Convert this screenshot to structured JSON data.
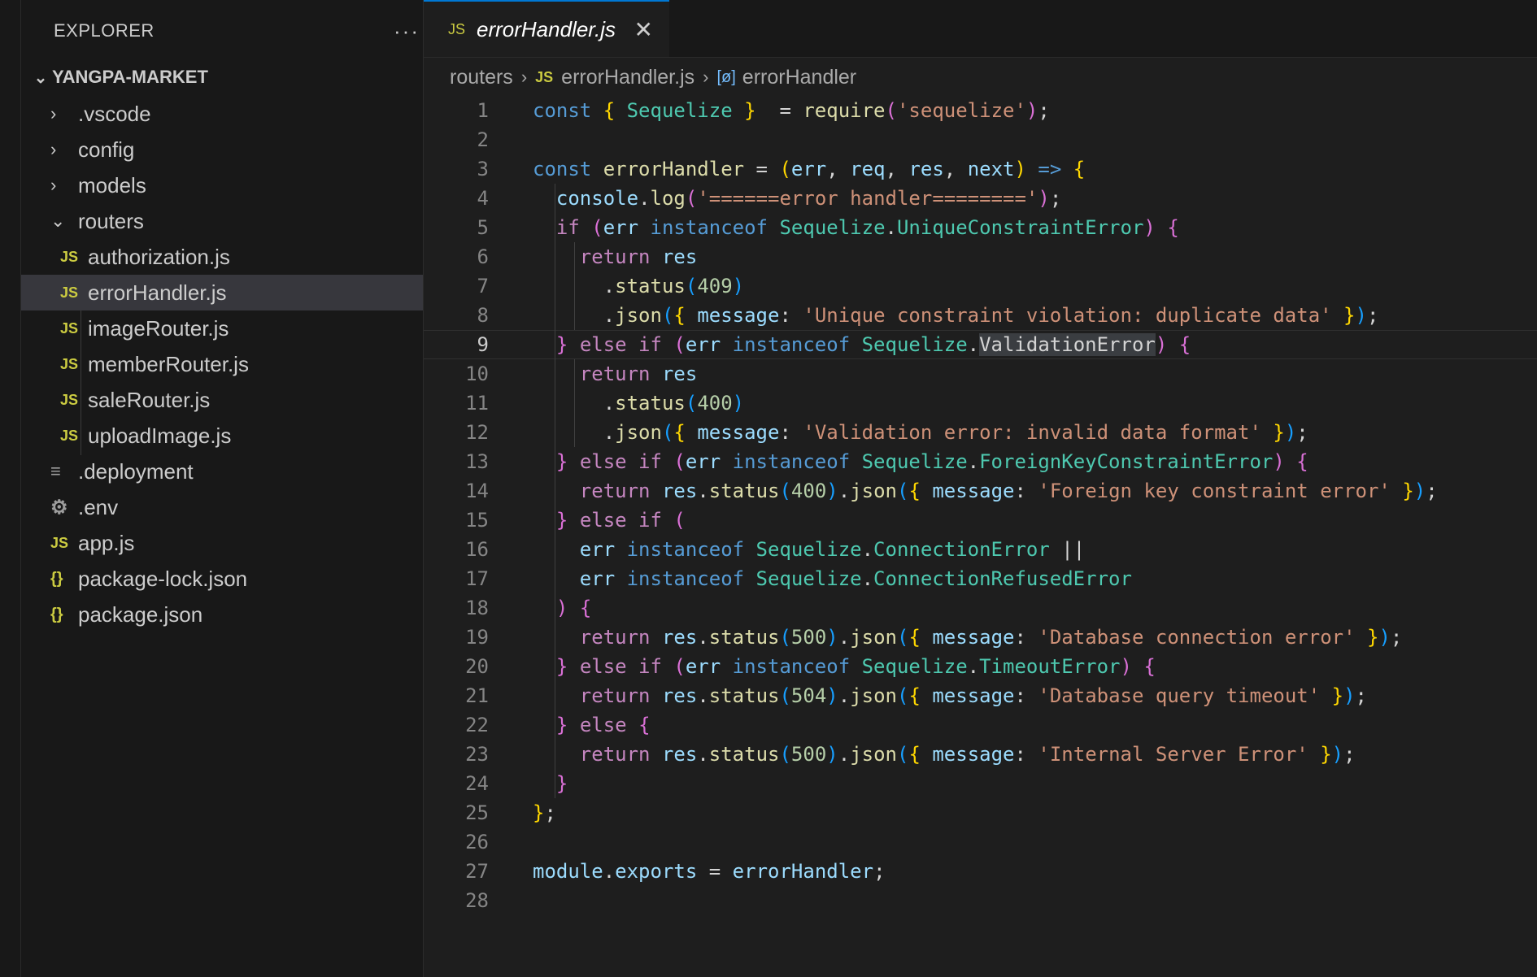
{
  "explorer": {
    "title": "EXPLORER",
    "more": "···",
    "project": "YANGPA-MARKET",
    "items": [
      {
        "label": ".vscode",
        "kind": "folder",
        "depth": 1
      },
      {
        "label": "config",
        "kind": "folder",
        "depth": 1
      },
      {
        "label": "models",
        "kind": "folder",
        "depth": 1
      },
      {
        "label": "routers",
        "kind": "folder-open",
        "depth": 1
      },
      {
        "label": "authorization.js",
        "kind": "js",
        "depth": 2
      },
      {
        "label": "errorHandler.js",
        "kind": "js",
        "depth": 2,
        "active": true
      },
      {
        "label": "imageRouter.js",
        "kind": "js",
        "depth": 2
      },
      {
        "label": "memberRouter.js",
        "kind": "js",
        "depth": 2
      },
      {
        "label": "saleRouter.js",
        "kind": "js",
        "depth": 2
      },
      {
        "label": "uploadImage.js",
        "kind": "js",
        "depth": 2
      },
      {
        "label": ".deployment",
        "kind": "lines",
        "depth": 1
      },
      {
        "label": ".env",
        "kind": "gear",
        "depth": 1
      },
      {
        "label": "app.js",
        "kind": "js",
        "depth": 1
      },
      {
        "label": "package-lock.json",
        "kind": "json",
        "depth": 1
      },
      {
        "label": "package.json",
        "kind": "json",
        "depth": 1
      }
    ]
  },
  "icons": {
    "js": "JS",
    "json": "{}",
    "gear": "⚙",
    "lines": "≡"
  },
  "tab": {
    "title": "errorHandler.js",
    "close": "✕"
  },
  "breadcrumb": {
    "folder": "routers",
    "file": "errorHandler.js",
    "symbol": "errorHandler"
  },
  "editor": {
    "current_line": 9,
    "lines": [
      [
        [
          "kw",
          "const "
        ],
        [
          "br1",
          "{ "
        ],
        [
          "ty",
          "Sequelize"
        ],
        [
          "br1",
          " }"
        ],
        [
          "",
          "  = "
        ],
        [
          "fn",
          "require"
        ],
        [
          "br2",
          "("
        ],
        [
          "str",
          "'sequelize'"
        ],
        [
          "br2",
          ")"
        ],
        [
          "",
          ";"
        ]
      ],
      [],
      [
        [
          "kw",
          "const "
        ],
        [
          "fn",
          "errorHandler"
        ],
        [
          "",
          " = "
        ],
        [
          "br1",
          "("
        ],
        [
          "vr",
          "err"
        ],
        [
          "",
          ", "
        ],
        [
          "vr",
          "req"
        ],
        [
          "",
          ", "
        ],
        [
          "vr",
          "res"
        ],
        [
          "",
          ", "
        ],
        [
          "vr",
          "next"
        ],
        [
          "br1",
          ")"
        ],
        [
          "",
          " "
        ],
        [
          "kw",
          "=>"
        ],
        [
          "",
          " "
        ],
        [
          "br1",
          "{"
        ]
      ],
      [
        [
          "",
          "  "
        ],
        [
          "vr",
          "console"
        ],
        [
          "",
          "."
        ],
        [
          "fn",
          "log"
        ],
        [
          "br2",
          "("
        ],
        [
          "str",
          "'======error handler========'"
        ],
        [
          "br2",
          ")"
        ],
        [
          "",
          ";"
        ]
      ],
      [
        [
          "",
          "  "
        ],
        [
          "ctl",
          "if "
        ],
        [
          "br2",
          "("
        ],
        [
          "vr",
          "err "
        ],
        [
          "kw",
          "instanceof "
        ],
        [
          "ty",
          "Sequelize"
        ],
        [
          "",
          "."
        ],
        [
          "ty",
          "UniqueConstraintError"
        ],
        [
          "br2",
          ")"
        ],
        [
          "",
          " "
        ],
        [
          "br2",
          "{"
        ]
      ],
      [
        [
          "",
          "    "
        ],
        [
          "ctl",
          "return "
        ],
        [
          "vr",
          "res"
        ]
      ],
      [
        [
          "",
          "      ."
        ],
        [
          "fn",
          "status"
        ],
        [
          "br3",
          "("
        ],
        [
          "num",
          "409"
        ],
        [
          "br3",
          ")"
        ]
      ],
      [
        [
          "",
          "      ."
        ],
        [
          "fn",
          "json"
        ],
        [
          "br3",
          "("
        ],
        [
          "br1",
          "{ "
        ],
        [
          "vr",
          "message"
        ],
        [
          "",
          ": "
        ],
        [
          "str",
          "'Unique constraint violation: duplicate data'"
        ],
        [
          "br1",
          " }"
        ],
        [
          "br3",
          ")"
        ],
        [
          "",
          ";"
        ]
      ],
      [
        [
          "",
          "  "
        ],
        [
          "br2",
          "}"
        ],
        [
          "",
          " "
        ],
        [
          "ctl",
          "else if "
        ],
        [
          "br2",
          "("
        ],
        [
          "vr",
          "err "
        ],
        [
          "kw",
          "instanceof "
        ],
        [
          "ty",
          "Sequelize"
        ],
        [
          "",
          "."
        ],
        [
          "hl",
          "ValidationError"
        ],
        [
          "br2",
          ")"
        ],
        [
          "",
          " "
        ],
        [
          "br2",
          "{"
        ]
      ],
      [
        [
          "",
          "    "
        ],
        [
          "ctl",
          "return "
        ],
        [
          "vr",
          "res"
        ]
      ],
      [
        [
          "",
          "      ."
        ],
        [
          "fn",
          "status"
        ],
        [
          "br3",
          "("
        ],
        [
          "num",
          "400"
        ],
        [
          "br3",
          ")"
        ]
      ],
      [
        [
          "",
          "      ."
        ],
        [
          "fn",
          "json"
        ],
        [
          "br3",
          "("
        ],
        [
          "br1",
          "{ "
        ],
        [
          "vr",
          "message"
        ],
        [
          "",
          ": "
        ],
        [
          "str",
          "'Validation error: invalid data format'"
        ],
        [
          "br1",
          " }"
        ],
        [
          "br3",
          ")"
        ],
        [
          "",
          ";"
        ]
      ],
      [
        [
          "",
          "  "
        ],
        [
          "br2",
          "}"
        ],
        [
          "",
          " "
        ],
        [
          "ctl",
          "else if "
        ],
        [
          "br2",
          "("
        ],
        [
          "vr",
          "err "
        ],
        [
          "kw",
          "instanceof "
        ],
        [
          "ty",
          "Sequelize"
        ],
        [
          "",
          "."
        ],
        [
          "ty",
          "ForeignKeyConstraintError"
        ],
        [
          "br2",
          ")"
        ],
        [
          "",
          " "
        ],
        [
          "br2",
          "{"
        ]
      ],
      [
        [
          "",
          "    "
        ],
        [
          "ctl",
          "return "
        ],
        [
          "vr",
          "res"
        ],
        [
          "",
          "."
        ],
        [
          "fn",
          "status"
        ],
        [
          "br3",
          "("
        ],
        [
          "num",
          "400"
        ],
        [
          "br3",
          ")"
        ],
        [
          "",
          "."
        ],
        [
          "fn",
          "json"
        ],
        [
          "br3",
          "("
        ],
        [
          "br1",
          "{ "
        ],
        [
          "vr",
          "message"
        ],
        [
          "",
          ": "
        ],
        [
          "str",
          "'Foreign key constraint error'"
        ],
        [
          "br1",
          " }"
        ],
        [
          "br3",
          ")"
        ],
        [
          "",
          ";"
        ]
      ],
      [
        [
          "",
          "  "
        ],
        [
          "br2",
          "}"
        ],
        [
          "",
          " "
        ],
        [
          "ctl",
          "else if "
        ],
        [
          "br2",
          "("
        ]
      ],
      [
        [
          "",
          "    "
        ],
        [
          "vr",
          "err "
        ],
        [
          "kw",
          "instanceof "
        ],
        [
          "ty",
          "Sequelize"
        ],
        [
          "",
          "."
        ],
        [
          "ty",
          "ConnectionError"
        ],
        [
          "",
          " ||"
        ]
      ],
      [
        [
          "",
          "    "
        ],
        [
          "vr",
          "err "
        ],
        [
          "kw",
          "instanceof "
        ],
        [
          "ty",
          "Sequelize"
        ],
        [
          "",
          "."
        ],
        [
          "ty",
          "ConnectionRefusedError"
        ]
      ],
      [
        [
          "",
          "  "
        ],
        [
          "br2",
          ")"
        ],
        [
          "",
          " "
        ],
        [
          "br2",
          "{"
        ]
      ],
      [
        [
          "",
          "    "
        ],
        [
          "ctl",
          "return "
        ],
        [
          "vr",
          "res"
        ],
        [
          "",
          "."
        ],
        [
          "fn",
          "status"
        ],
        [
          "br3",
          "("
        ],
        [
          "num",
          "500"
        ],
        [
          "br3",
          ")"
        ],
        [
          "",
          "."
        ],
        [
          "fn",
          "json"
        ],
        [
          "br3",
          "("
        ],
        [
          "br1",
          "{ "
        ],
        [
          "vr",
          "message"
        ],
        [
          "",
          ": "
        ],
        [
          "str",
          "'Database connection error'"
        ],
        [
          "br1",
          " }"
        ],
        [
          "br3",
          ")"
        ],
        [
          "",
          ";"
        ]
      ],
      [
        [
          "",
          "  "
        ],
        [
          "br2",
          "}"
        ],
        [
          "",
          " "
        ],
        [
          "ctl",
          "else if "
        ],
        [
          "br2",
          "("
        ],
        [
          "vr",
          "err "
        ],
        [
          "kw",
          "instanceof "
        ],
        [
          "ty",
          "Sequelize"
        ],
        [
          "",
          "."
        ],
        [
          "ty",
          "TimeoutError"
        ],
        [
          "br2",
          ")"
        ],
        [
          "",
          " "
        ],
        [
          "br2",
          "{"
        ]
      ],
      [
        [
          "",
          "    "
        ],
        [
          "ctl",
          "return "
        ],
        [
          "vr",
          "res"
        ],
        [
          "",
          "."
        ],
        [
          "fn",
          "status"
        ],
        [
          "br3",
          "("
        ],
        [
          "num",
          "504"
        ],
        [
          "br3",
          ")"
        ],
        [
          "",
          "."
        ],
        [
          "fn",
          "json"
        ],
        [
          "br3",
          "("
        ],
        [
          "br1",
          "{ "
        ],
        [
          "vr",
          "message"
        ],
        [
          "",
          ": "
        ],
        [
          "str",
          "'Database query timeout'"
        ],
        [
          "br1",
          " }"
        ],
        [
          "br3",
          ")"
        ],
        [
          "",
          ";"
        ]
      ],
      [
        [
          "",
          "  "
        ],
        [
          "br2",
          "}"
        ],
        [
          "",
          " "
        ],
        [
          "ctl",
          "else "
        ],
        [
          "br2",
          "{"
        ]
      ],
      [
        [
          "",
          "    "
        ],
        [
          "ctl",
          "return "
        ],
        [
          "vr",
          "res"
        ],
        [
          "",
          "."
        ],
        [
          "fn",
          "status"
        ],
        [
          "br3",
          "("
        ],
        [
          "num",
          "500"
        ],
        [
          "br3",
          ")"
        ],
        [
          "",
          "."
        ],
        [
          "fn",
          "json"
        ],
        [
          "br3",
          "("
        ],
        [
          "br1",
          "{ "
        ],
        [
          "vr",
          "message"
        ],
        [
          "",
          ": "
        ],
        [
          "str",
          "'Internal Server Error'"
        ],
        [
          "br1",
          " }"
        ],
        [
          "br3",
          ")"
        ],
        [
          "",
          ";"
        ]
      ],
      [
        [
          "",
          "  "
        ],
        [
          "br2",
          "}"
        ]
      ],
      [
        [
          "br1",
          "}"
        ],
        [
          "",
          ";"
        ]
      ],
      [],
      [
        [
          "vr",
          "module"
        ],
        [
          "",
          "."
        ],
        [
          "vr",
          "exports"
        ],
        [
          "",
          " = "
        ],
        [
          "vr",
          "errorHandler"
        ],
        [
          "",
          ";"
        ]
      ],
      []
    ]
  }
}
